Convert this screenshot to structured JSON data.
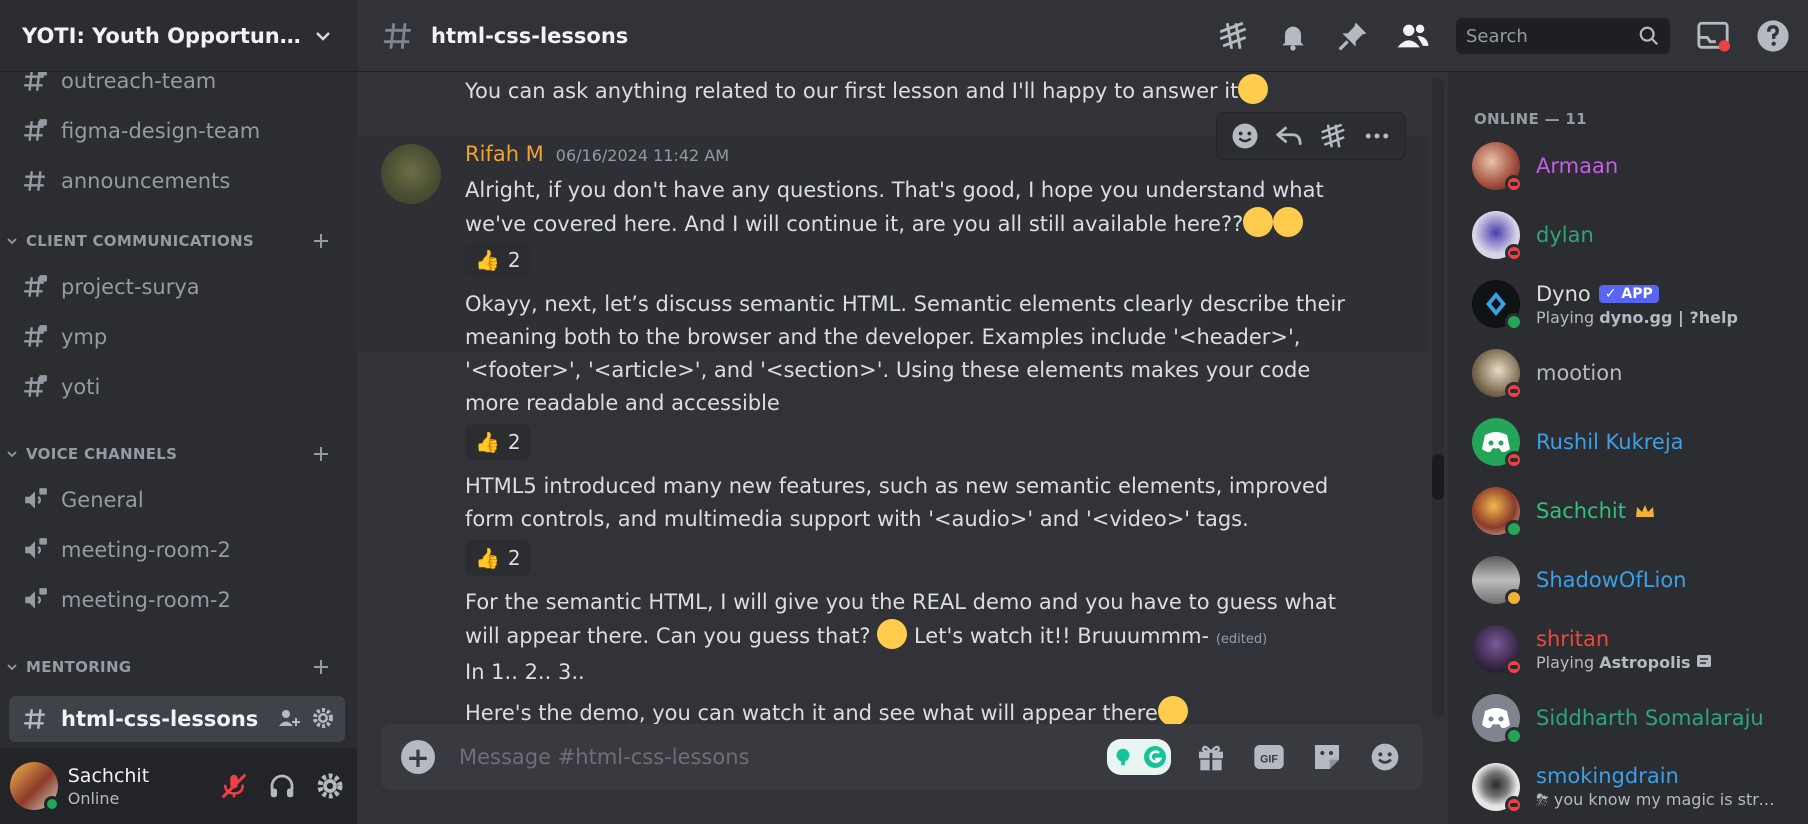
{
  "server": {
    "name": "YOTI: Youth Opportuniti..."
  },
  "channels": {
    "top": [
      {
        "label": "outreach-team"
      },
      {
        "label": "figma-design-team"
      },
      {
        "label": "announcements"
      }
    ],
    "categories": [
      {
        "label": "CLIENT COMMUNICATIONS",
        "items": [
          {
            "label": "project-surya"
          },
          {
            "label": "ymp"
          },
          {
            "label": "yoti"
          }
        ]
      },
      {
        "label": "VOICE CHANNELS",
        "items": [
          {
            "label": "General"
          },
          {
            "label": "meeting-room-2"
          },
          {
            "label": "meeting-room-2"
          }
        ]
      },
      {
        "label": "MENTORING",
        "items": [
          {
            "label": "html-css-lessons"
          }
        ]
      }
    ]
  },
  "user": {
    "name": "Sachchit",
    "status": "Online"
  },
  "header": {
    "channel": "html-css-lessons",
    "search_placeholder": "Search"
  },
  "messages": {
    "prev_line": "You can ask anything related to our first lesson and I'll happy to answer it",
    "author": "Rifah M",
    "timestamp": "06/16/2024 11:42 AM",
    "m1": "Alright, if you don't have any questions. That's good, I hope you understand what we've covered here. And I will continue it, are you all still available here??",
    "m1_reaction": "2",
    "m2": "Okayy, next, let’s discuss semantic HTML. Semantic elements clearly describe their meaning both to the browser and the developer. Examples include '<header>', '<footer>', '<article>', and '<section>'. Using these elements makes your code more readable and accessible",
    "m2_reaction": "2",
    "m3": "HTML5 introduced many new features, such as new semantic elements, improved form controls, and multimedia support with '<audio>' and '<video>' tags.",
    "m3_reaction": "2",
    "m4a": "For the semantic HTML, I will give you the REAL demo and you have to guess what will appear there. Can you guess that?",
    "m4b": "Let's watch it!! Bruuummm-",
    "m4_edited": "(edited)",
    "m5": "In 1.. 2.. 3..",
    "m6": "Here's the demo, you can watch it and see what will appear there"
  },
  "composer": {
    "placeholder": "Message #html-css-lessons"
  },
  "members": {
    "title": "ONLINE — 11",
    "list": [
      {
        "name": "Armaan",
        "color": "#c260e0",
        "status": "dnd",
        "avatar": "#a14a3a"
      },
      {
        "name": "dylan",
        "color": "#2ea57a",
        "status": "dnd",
        "avatar": "#d8d4e8"
      },
      {
        "name": "Dyno",
        "color": "#dbdee1",
        "status": "on",
        "badge": "APP",
        "sub_prefix": "Playing ",
        "sub": "dyno.gg | ?help",
        "avatar": "#1e1f22"
      },
      {
        "name": "mootion",
        "color": "#b5bac1",
        "status": "dnd",
        "avatar": "#7a6a50"
      },
      {
        "name": "Rushil Kukreja",
        "color": "#3aa0e8",
        "status": "dnd",
        "avatar": "#23a55a"
      },
      {
        "name": "Sachchit",
        "color": "#2ec27e",
        "status": "on",
        "crown": true,
        "avatar": "#e8a33a"
      },
      {
        "name": "ShadowOfLion",
        "color": "#3aa0e8",
        "status": "idle",
        "avatar": "#9a9a9a"
      },
      {
        "name": "shritan",
        "color": "#f2463a",
        "status": "dnd",
        "sub_prefix": "Playing ",
        "sub": "Astropolis",
        "avatar": "#3c2a4a"
      },
      {
        "name": "Siddharth Somalaraju",
        "color": "#2ea57a",
        "status": "on",
        "avatar": "#80848e"
      },
      {
        "name": "smokingdrain",
        "color": "#3aa0e8",
        "status": "dnd",
        "sub": "you know my magic is stro...",
        "avatar": "#e6e6e6"
      }
    ]
  },
  "colors": {
    "bg": "#313338",
    "sidebar": "#2b2d31",
    "accent": "#5865f2",
    "online": "#23a55a",
    "dnd": "#f23f43",
    "author": "#f0a232"
  }
}
